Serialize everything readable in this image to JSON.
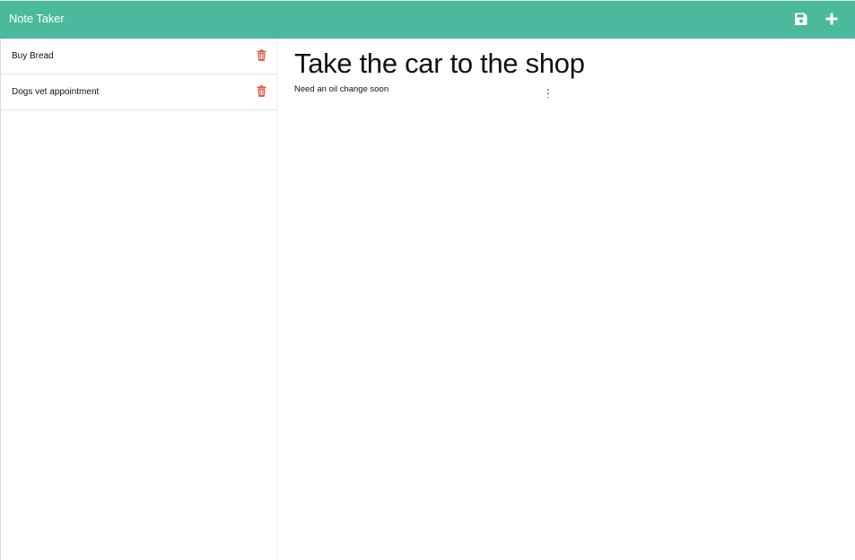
{
  "navbar": {
    "brand": "Note Taker",
    "color": "#4bb99c",
    "save_icon": "floppy-disk-icon",
    "new_icon": "plus-icon"
  },
  "sidebar": {
    "notes": [
      {
        "title": "Buy Bread",
        "delete_icon": "trash-icon"
      },
      {
        "title": "Dogs vet appointment",
        "delete_icon": "trash-icon"
      }
    ],
    "delete_color": "#e05a47"
  },
  "editor": {
    "title": "Take the car to the shop",
    "body": "Need an oil change soon"
  }
}
